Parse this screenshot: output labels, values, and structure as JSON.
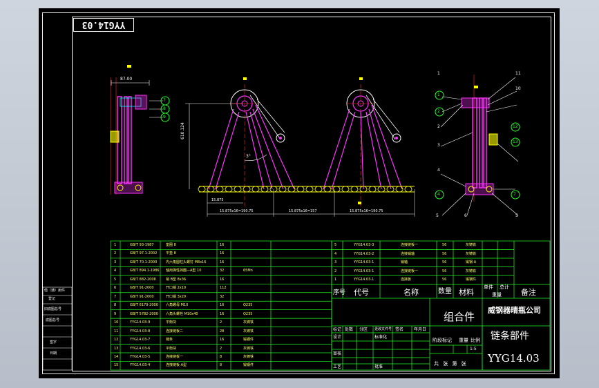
{
  "drawing_code": "YYG14.03",
  "drawing_code_flipped": "YYG14.03",
  "title_block": {
    "assembly_label": "组合件",
    "company": "威钢器晴瓶公司",
    "part_name": "链条部件",
    "drawing_number": "YYG14.03",
    "scale": "1:5",
    "header_cols": {
      "seq": "序号",
      "code": "代号",
      "name": "名称",
      "qty": "数量",
      "material": "材料",
      "unit_weight": "单件",
      "total_weight": "总计",
      "weight": "重量",
      "remark": "备注"
    },
    "rev_cols": [
      "标记",
      "处数",
      "分区",
      "更改文件号",
      "签名",
      "年月日"
    ],
    "design": "设计",
    "standardize": "标准化",
    "review": "审核",
    "process": "工艺",
    "approve": "批准",
    "stage_mark": "阶段标记",
    "weight_label": "重量",
    "scale_label": "比例",
    "sheet_info": "共 张 第 张"
  },
  "side_strip": [
    "借（通）用件",
    "登记",
    "旧底图总号",
    "底图总号",
    "签字",
    "日期"
  ],
  "dimensions": {
    "top_left_width": "87.00",
    "vertical": "610.124",
    "base_len": "15.875",
    "chain1": "15.875x16=190.75",
    "chain2": "15.875x16=157",
    "chain3": "15.875x16=190.75",
    "angle": "3°"
  },
  "balloons_left": [
    "7",
    "8",
    "9"
  ],
  "balloons_right_top": [
    "1",
    "2",
    "3",
    "4",
    "5"
  ],
  "balloons_right_side": [
    "10",
    "11",
    "12",
    "13"
  ],
  "balloons_right_bottom": [
    "4",
    "5",
    "6",
    "7"
  ],
  "bom_left": [
    {
      "no": "1",
      "code": "GB/T 93-1987",
      "name": "垫圈 8",
      "qty": "16",
      "mat": ""
    },
    {
      "no": "2",
      "code": "GB/T 97.1-2002",
      "name": "平垫 8",
      "qty": "16",
      "mat": ""
    },
    {
      "no": "3",
      "code": "GB/T 70.1-2000",
      "name": "内六角圆柱头螺钉 M8x16",
      "qty": "16",
      "mat": ""
    },
    {
      "no": "4",
      "code": "GB/T 894.1-1986",
      "name": "轴用弹性挡圈—A型 10",
      "qty": "32",
      "mat": "65Mn"
    },
    {
      "no": "5",
      "code": "GB/T 882-2008",
      "name": "销 B型 8x36",
      "qty": "16",
      "mat": ""
    },
    {
      "no": "6",
      "code": "GB/T 91-2000",
      "name": "开口销 2x10",
      "qty": "112",
      "mat": ""
    },
    {
      "no": "7",
      "code": "GB/T 91-2000",
      "name": "开口销 3x20",
      "qty": "32",
      "mat": ""
    },
    {
      "no": "8",
      "code": "GB/T 6170-2000",
      "name": "六角螺母 M10",
      "qty": "16",
      "mat": "Q235"
    },
    {
      "no": "9",
      "code": "GB/T 5782-2000",
      "name": "六角头螺栓 M10x40",
      "qty": "16",
      "mat": "Q235"
    },
    {
      "no": "10",
      "code": "YYG14.03-9",
      "name": "平衡块",
      "qty": "2",
      "mat": "灰铸铁"
    },
    {
      "no": "11",
      "code": "YYG14.03-8",
      "name": "连接链板二",
      "qty": "28",
      "mat": "灰铸铁"
    },
    {
      "no": "12",
      "code": "YYG14.03-7",
      "name": "链条",
      "qty": "16",
      "mat": "锻钢件"
    },
    {
      "no": "13",
      "code": "YYG14.03-6",
      "name": "平衡块",
      "qty": "2",
      "mat": "灰铸铁"
    },
    {
      "no": "14",
      "code": "YYG14.03-5",
      "name": "连接链板一",
      "qty": "8",
      "mat": "灰铸铁"
    },
    {
      "no": "15",
      "code": "YYG14.03-4",
      "name": "连接链板 A型",
      "qty": "8",
      "mat": "锻钢件"
    }
  ],
  "bom_right": [
    {
      "no": "5",
      "code": "YYG14.03-3",
      "name": "连接链板一",
      "qty": "56",
      "mat": "灰铸铁"
    },
    {
      "no": "4",
      "code": "YYG14.03-2",
      "name": "连接销轴",
      "qty": "56",
      "mat": "灰铸铁"
    },
    {
      "no": "3",
      "code": "YYG14.03-1",
      "name": "销轴",
      "qty": "56",
      "mat": "锻钢-A"
    },
    {
      "no": "2",
      "code": "YYG14.03-1",
      "name": "连接链板一",
      "qty": "56",
      "mat": "灰铸铁"
    },
    {
      "no": "1",
      "code": "YYG14.03-1",
      "name": "连接板",
      "qty": "56",
      "mat": "锻钢件"
    }
  ]
}
